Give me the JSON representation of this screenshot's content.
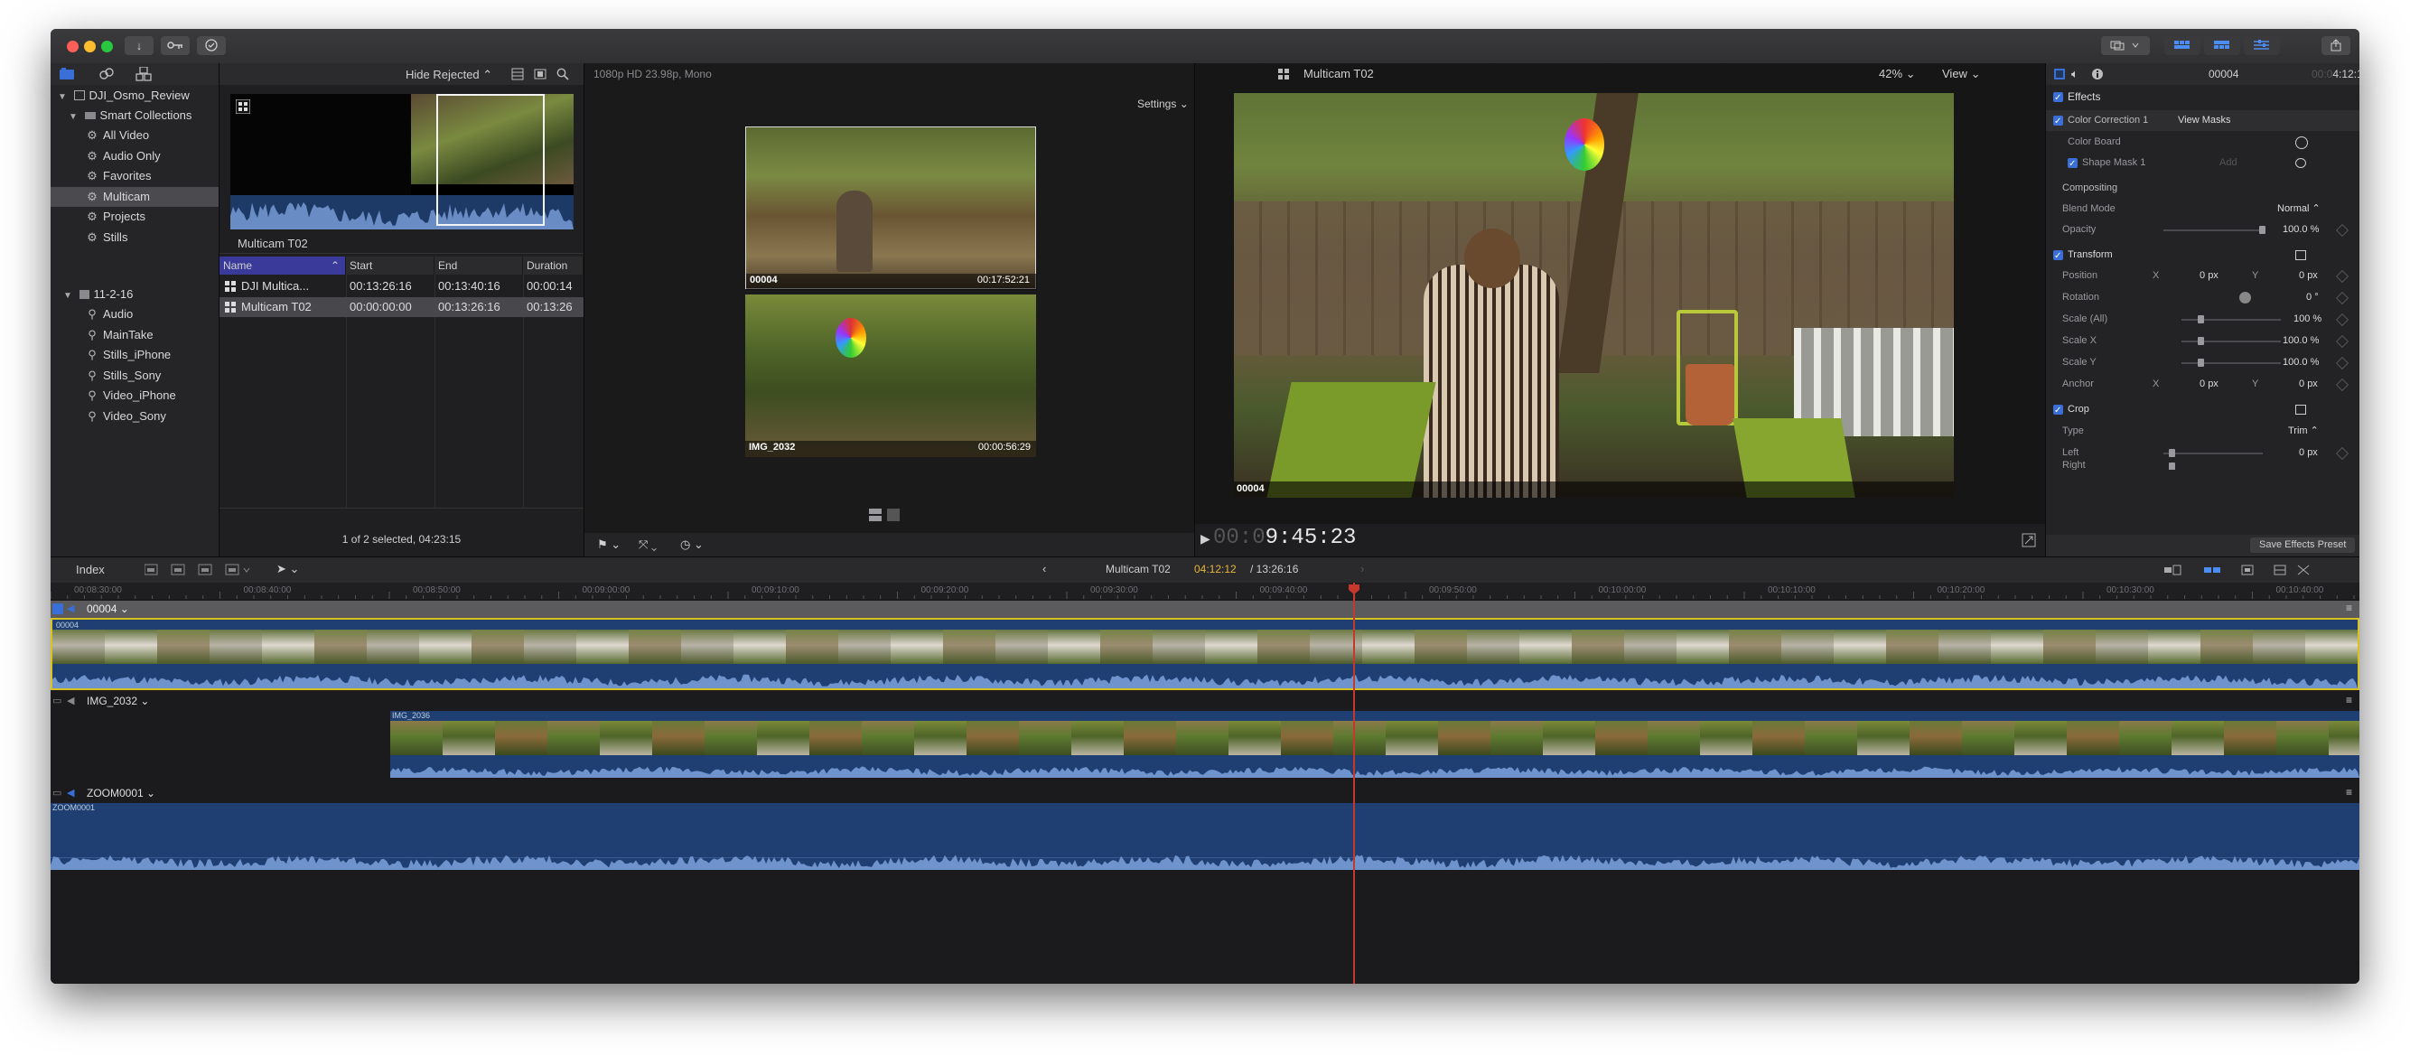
{
  "titlebar": {
    "download_icon": "↓",
    "keywords_icon": "key",
    "check_icon": "✓",
    "share_icon": "share"
  },
  "library": {
    "name": "DJI_Osmo_Review",
    "smart_collections": "Smart Collections",
    "smart_items": [
      "All Video",
      "Audio Only",
      "Favorites",
      "Multicam",
      "Projects",
      "Stills"
    ],
    "event": "11-2-16",
    "keyword_items": [
      "Audio",
      "MainTake",
      "Stills_iPhone",
      "Stills_Sony",
      "Video_iPhone",
      "Video_Sony"
    ]
  },
  "browser": {
    "filter": "Hide Rejected",
    "clip_label": "Multicam T02",
    "columns": [
      "Name",
      "Start",
      "End",
      "Duration"
    ],
    "rows": [
      {
        "name": "DJI Multica...",
        "start": "00:13:26:16",
        "end": "00:13:40:16",
        "duration": "00:00:14"
      },
      {
        "name": "Multicam T02",
        "start": "00:00:00:00",
        "end": "00:13:26:16",
        "duration": "00:13:26"
      }
    ],
    "status": "1 of 2 selected, 04:23:15"
  },
  "angle_viewer": {
    "format": "1080p HD 23.98p, Mono",
    "settings": "Settings",
    "angles": [
      {
        "name": "00004",
        "timecode": "00:17:52:21"
      },
      {
        "name": "IMG_2032",
        "timecode": "00:00:56:29"
      }
    ]
  },
  "viewer": {
    "title": "Multicam T02",
    "zoom": "42%",
    "view": "View",
    "angle_label": "00004",
    "timecode_dim": "00:0",
    "timecode": "9:45:23"
  },
  "inspector": {
    "clip_name": "00004",
    "duration_dim": "00:0",
    "duration": "4:12:12",
    "effects": "Effects",
    "color_correction": "Color Correction 1",
    "view_masks": "View Masks",
    "color_board": "Color Board",
    "shape_mask": "Shape Mask 1",
    "add": "Add",
    "compositing": "Compositing",
    "blend_mode": "Blend Mode",
    "blend_value": "Normal",
    "opacity": "Opacity",
    "opacity_value": "100.0",
    "pct": "%",
    "transform": "Transform",
    "position": "Position",
    "x": "X",
    "y": "Y",
    "px": "px",
    "zero": "0",
    "rotation": "Rotation",
    "degree": "°",
    "scale_all": "Scale (All)",
    "scale_all_value": "100",
    "scale_x": "Scale X",
    "scale_x_value": "100.0",
    "scale_y": "Scale Y",
    "scale_y_value": "100.0",
    "anchor": "Anchor",
    "crop": "Crop",
    "type": "Type",
    "type_value": "Trim",
    "left": "Left",
    "right": "Right",
    "save_preset": "Save Effects Preset"
  },
  "timeline": {
    "index": "Index",
    "project": "Multicam T02",
    "position": "04:12:12",
    "total": "/ 13:26:16",
    "ruler": [
      "00:08:30:00",
      "00:08:40:00",
      "00:08:50:00",
      "00:09:00:00",
      "00:09:10:00",
      "00:09:20:00",
      "00:09:30:00",
      "00:09:40:00",
      "00:09:50:00",
      "00:10:00:00",
      "00:10:10:00",
      "00:10:20:00",
      "00:10:30:00",
      "00:10:40:00"
    ],
    "lanes": [
      {
        "name": "00004",
        "clip": "00004"
      },
      {
        "name": "IMG_2032",
        "clip": "IMG_2036"
      },
      {
        "name": "ZOOM0001",
        "clip": "ZOOM0001"
      }
    ]
  },
  "colors": {
    "accent": "#3b6fd8",
    "playhead": "#c6382b",
    "timecode": "#e6b53c",
    "active_lane": "#d9c11f",
    "audio": "#1f3f72"
  }
}
